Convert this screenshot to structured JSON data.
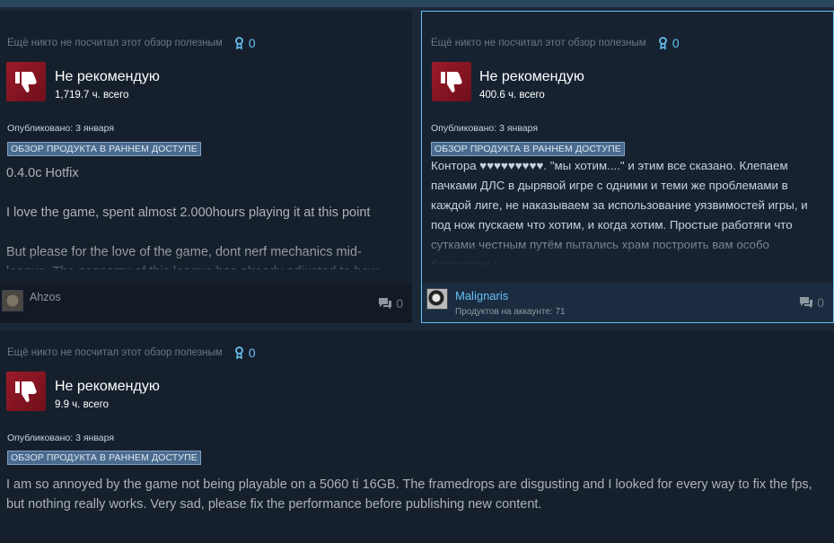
{
  "reviews": [
    {
      "helpful_text": "Ещё никто не посчитал этот обзор полезным",
      "award_count": "0",
      "verdict": "Не рекомендую",
      "hours": "1,719.7 ч. всего",
      "posted": "Опубликовано: 3 января",
      "early_access": "ОБЗОР ПРОДУКТА В РАННЕМ ДОСТУПЕ",
      "paragraphs": [
        "0.4.0c Hotfix",
        "I love the game, spent almost 2.000hours playing it at this point",
        "But please for the love of the game, dont nerf mechanics mid-league. The economy of this league has already adjusted to how"
      ],
      "author": "Ahzos",
      "comment_count": "0"
    },
    {
      "helpful_text": "Ещё никто не посчитал этот обзор полезным",
      "award_count": "0",
      "verdict": "Не рекомендую",
      "hours": "400.6 ч. всего",
      "posted": "Опубликовано: 3 января",
      "early_access": "ОБЗОР ПРОДУКТА В РАННЕМ ДОСТУПЕ",
      "paragraphs": [
        "Контора ♥♥♥♥♥♥♥♥♥. \"мы хотим....\" и этим все сказано. Клепаем пачками ДЛС в дырявой игре с одними и теми же проблемами в каждой лиге, не наказываем за использование уязвимостей игры, и под нож пускаем что хотим, и когда хотим. Простые работяги что сутками честным путём пытались храм построить вам особо благодарны"
      ],
      "author": "Malignaris",
      "products": "Продуктов на аккаунте: 71",
      "comment_count": "0"
    },
    {
      "helpful_text": "Ещё никто не посчитал этот обзор полезным",
      "award_count": "0",
      "verdict": "Не рекомендую",
      "hours": "9.9 ч. всего",
      "posted": "Опубликовано: 3 января",
      "early_access": "ОБЗОР ПРОДУКТА В РАННЕМ ДОСТУПЕ",
      "paragraphs": [
        "I am so annoyed by the game not being playable on a 5060 ti 16GB. The framedrops are disgusting and I looked for every way to fix the fps, but nothing really works. Very sad, please fix the performance before publishing new content."
      ]
    }
  ],
  "icons": {
    "thumb": "thumbs-down-icon",
    "award": "award-ribbon-icon",
    "comment": "speech-bubble-icon"
  },
  "colors": {
    "background": "#1b2838",
    "card": "#16202d",
    "accent": "#66c0f4",
    "thumbs_down": "#9b1b2a",
    "badge": "#4a6b8e"
  }
}
